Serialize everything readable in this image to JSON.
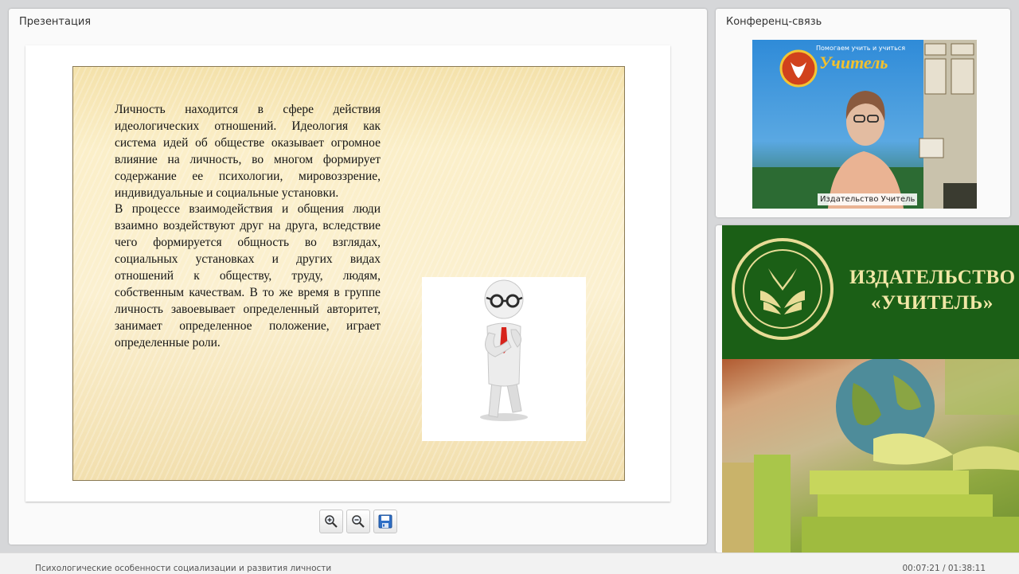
{
  "presentation": {
    "title": "Презентация",
    "slide": {
      "paragraph1": "Личность находится в сфере действия идеологических отношений. Идеология как система идей об обществе оказывает огромное влияние на личность, во многом формирует содержание ее психологии, мировоззрение, индивидуальные и социальные установки.",
      "paragraph2": "В процессе взаимодействия и общения люди взаимно воздействуют друг на друга, вследствие чего формируется общность во взглядах, социальных установках и других видах отношений к обществу, труду, людям, собственным качествам. В то же время в группе личность завоевывает определенный авторитет, занимает определенное положение, играет определенные роли."
    },
    "toolbar": {
      "zoom_in_icon": "zoom-in-icon",
      "zoom_out_icon": "zoom-out-icon",
      "save_icon": "save-icon"
    }
  },
  "conference": {
    "title": "Конференц-связь",
    "video_caption": "Издательство Учитель",
    "banner_heading": "Помогаем учить и учиться",
    "banner_brand": "Учитель"
  },
  "logo": {
    "line1": "ИЗДАТЕЛЬСТВО",
    "line2": "«УЧИТЕЛЬ»"
  },
  "status": {
    "webinar_title": "Психологические особенности социализации и развития личности",
    "time": "00:07:21 / 01:38:11"
  },
  "colors": {
    "logo_green": "#1b5f16",
    "logo_gold": "#e8dc96",
    "slide_bg": "#fbefc9"
  }
}
